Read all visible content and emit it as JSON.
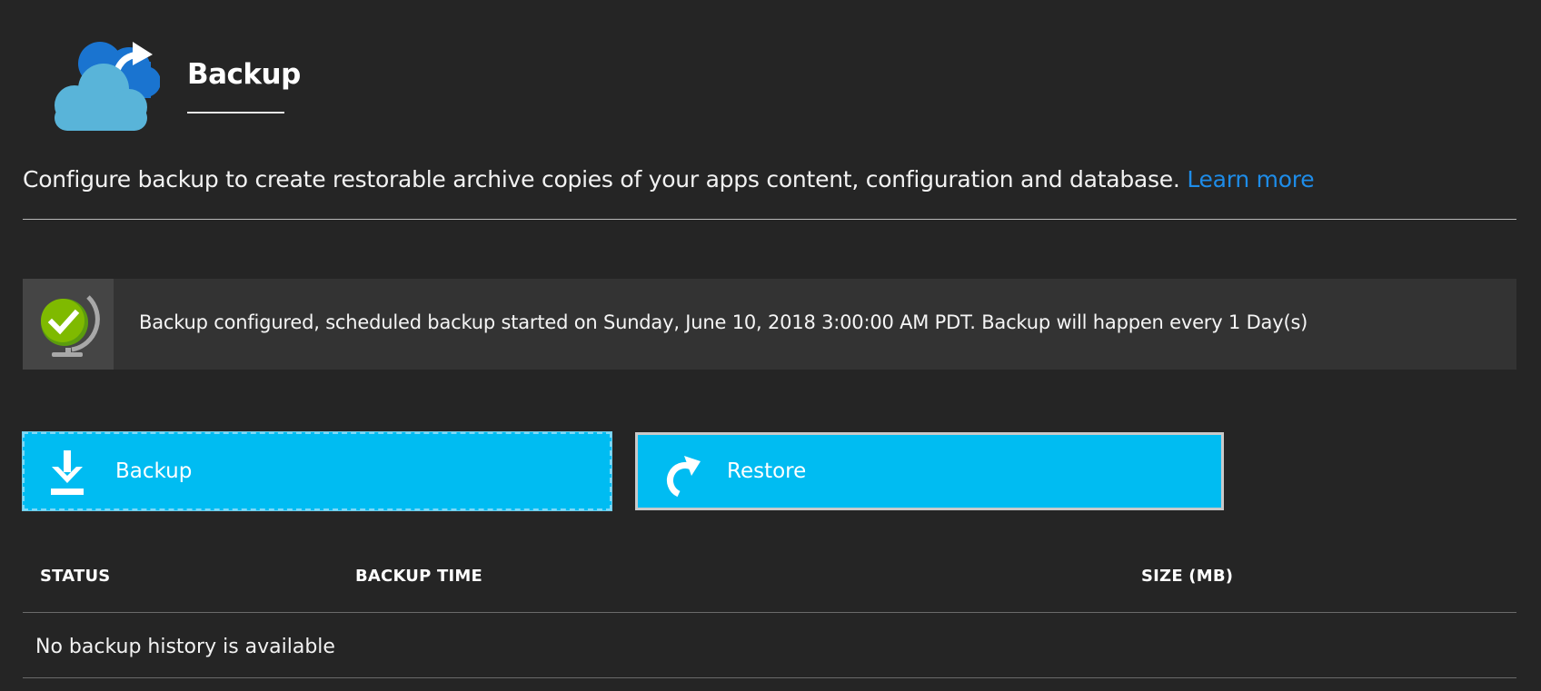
{
  "header": {
    "title": "Backup",
    "icon": "cloud-backup-icon"
  },
  "description": {
    "text": "Configure backup to create restorable archive copies of your apps content, configuration and database.",
    "link_label": "Learn more",
    "link_color": "#1e8ce8"
  },
  "status_banner": {
    "icon": "globe-check-icon",
    "message": "Backup configured, scheduled backup started on Sunday, June 10, 2018 3:00:00 AM PDT. Backup will happen every 1 Day(s)"
  },
  "actions": {
    "backup_label": "Backup",
    "backup_icon": "download-icon",
    "restore_label": "Restore",
    "restore_icon": "restore-arrow-icon",
    "accent_color": "#00bcf2"
  },
  "table": {
    "columns": [
      "STATUS",
      "BACKUP TIME",
      "SIZE (MB)"
    ],
    "empty_message": "No backup history is available"
  }
}
